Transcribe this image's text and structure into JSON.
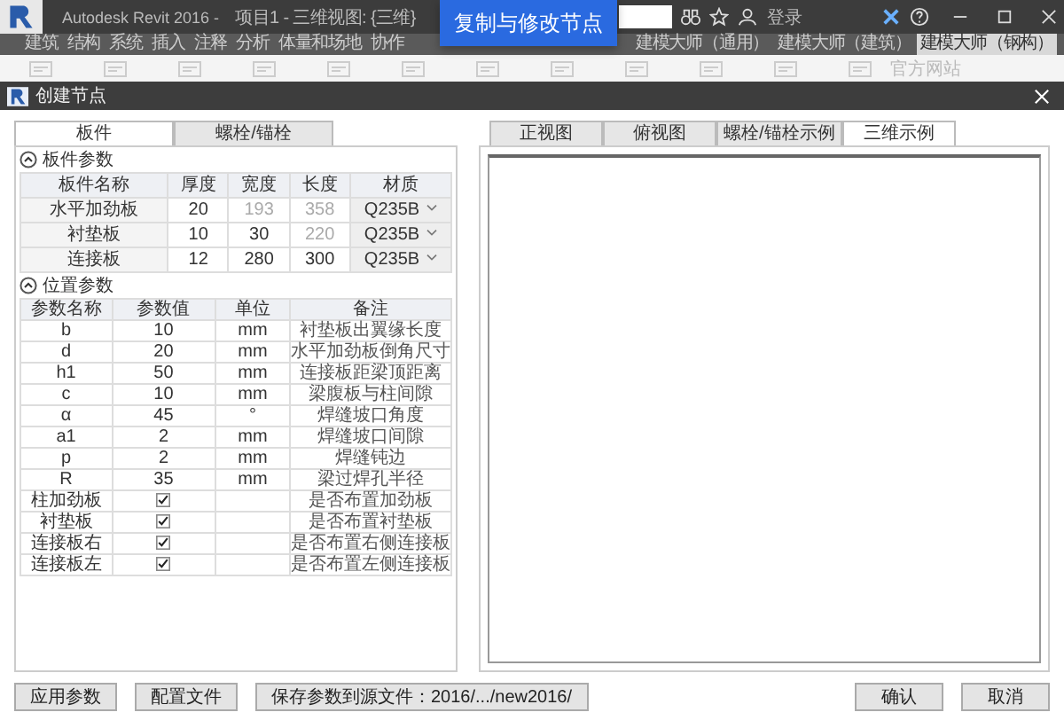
{
  "app": {
    "name": "Autodesk Revit 2016 -",
    "project": "项目1 - 三维视图: {三维}",
    "login": "登录"
  },
  "ribbon_tabs": [
    {
      "label": "建筑",
      "selected": false
    },
    {
      "label": "结构",
      "selected": false
    },
    {
      "label": "系统",
      "selected": false
    },
    {
      "label": "插入",
      "selected": false
    },
    {
      "label": "注释",
      "selected": false
    },
    {
      "label": "分析",
      "selected": false
    },
    {
      "label": "体量和场地",
      "selected": false
    },
    {
      "label": "协作",
      "selected": false
    },
    {
      "label": "建模大师（通用）",
      "selected": false
    },
    {
      "label": "建模大师（建筑）",
      "selected": false
    },
    {
      "label": "建模大师（钢构）",
      "selected": true
    }
  ],
  "ribbon_link": "官方网站",
  "caption": "复制与修改节点",
  "dialog": {
    "title": "创建节点",
    "left_tabs": [
      {
        "label": "板件",
        "selected": true
      },
      {
        "label": "螺栓/锚栓",
        "selected": false
      }
    ],
    "plate_section": {
      "title": "板件参数",
      "expanded": true,
      "columns": [
        "板件名称",
        "厚度",
        "宽度",
        "长度",
        "材质"
      ],
      "rows": [
        {
          "name": "水平加劲板",
          "thickness": {
            "value": "20",
            "disabled": false
          },
          "width": {
            "value": "193",
            "disabled": true
          },
          "length": {
            "value": "358",
            "disabled": true
          },
          "material": "Q235B"
        },
        {
          "name": "衬垫板",
          "thickness": {
            "value": "10",
            "disabled": false
          },
          "width": {
            "value": "30",
            "disabled": false
          },
          "length": {
            "value": "220",
            "disabled": true
          },
          "material": "Q235B"
        },
        {
          "name": "连接板",
          "thickness": {
            "value": "12",
            "disabled": false
          },
          "width": {
            "value": "280",
            "disabled": false
          },
          "length": {
            "value": "300",
            "disabled": false
          },
          "material": "Q235B"
        }
      ]
    },
    "position_section": {
      "title": "位置参数",
      "expanded": true,
      "columns": [
        "参数名称",
        "参数值",
        "单位",
        "备注"
      ],
      "rows": [
        {
          "kind": "value",
          "name": "b",
          "value": "10",
          "unit": "mm",
          "note": "衬垫板出翼缘长度"
        },
        {
          "kind": "value",
          "name": "d",
          "value": "20",
          "unit": "mm",
          "note": "水平加劲板倒角尺寸"
        },
        {
          "kind": "value",
          "name": "h1",
          "value": "50",
          "unit": "mm",
          "note": "连接板距梁顶距离"
        },
        {
          "kind": "value",
          "name": "c",
          "value": "10",
          "unit": "mm",
          "note": "梁腹板与柱间隙"
        },
        {
          "kind": "value",
          "name": "α",
          "value": "45",
          "unit": "°",
          "note": "焊缝坡口角度"
        },
        {
          "kind": "value",
          "name": "a1",
          "value": "2",
          "unit": "mm",
          "note": "焊缝坡口间隙"
        },
        {
          "kind": "value",
          "name": "p",
          "value": "2",
          "unit": "mm",
          "note": "焊缝钝边"
        },
        {
          "kind": "value",
          "name": "R",
          "value": "35",
          "unit": "mm",
          "note": "梁过焊孔半径"
        },
        {
          "kind": "check",
          "name": "柱加劲板",
          "checked": true,
          "note": "是否布置加劲板"
        },
        {
          "kind": "check",
          "name": "衬垫板",
          "checked": true,
          "note": "是否布置衬垫板"
        },
        {
          "kind": "check",
          "name": "连接板右",
          "checked": true,
          "note": "是否布置右侧连接板"
        },
        {
          "kind": "check",
          "name": "连接板左",
          "checked": true,
          "note": "是否布置左侧连接板"
        }
      ]
    },
    "right_tabs": [
      {
        "label": "正视图",
        "selected": false
      },
      {
        "label": "俯视图",
        "selected": false
      },
      {
        "label": "螺栓/锚栓示例",
        "selected": false
      },
      {
        "label": "三维示例",
        "selected": true
      }
    ],
    "left_buttons": [
      "应用参数",
      "配置文件",
      "保存参数到源文件：2016/.../new2016/"
    ],
    "right_buttons": [
      "确认",
      "取消"
    ]
  }
}
